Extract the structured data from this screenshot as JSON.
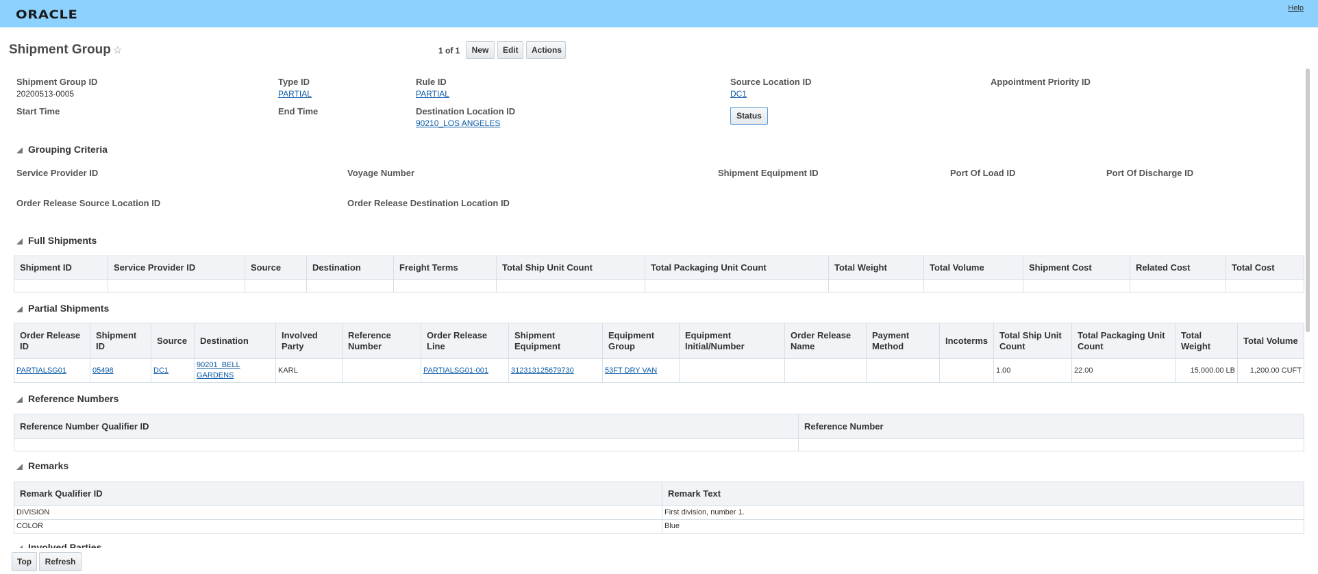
{
  "header": {
    "logo": "ORACLE",
    "help": "Help"
  },
  "page": {
    "title": "Shipment Group",
    "pager": "1 of 1",
    "new": "New",
    "edit": "Edit",
    "actions": "Actions",
    "status": "Status"
  },
  "fields": {
    "shipment_group_id": {
      "label": "Shipment Group ID",
      "value": "20200513-0005"
    },
    "type_id": {
      "label": "Type ID",
      "value": "PARTIAL"
    },
    "rule_id": {
      "label": "Rule ID",
      "value": "PARTIAL"
    },
    "source_location_id": {
      "label": "Source Location ID",
      "value": "DC1"
    },
    "appointment_priority_id": {
      "label": "Appointment Priority ID"
    },
    "start_time": {
      "label": "Start Time"
    },
    "end_time": {
      "label": "End Time"
    },
    "destination_location_id": {
      "label": "Destination Location ID",
      "value": "90210_LOS ANGELES"
    }
  },
  "grouping": {
    "title": "Grouping Criteria",
    "labels": [
      "Service Provider ID",
      "Voyage Number",
      "Shipment Equipment ID",
      "Port Of Load ID",
      "Port Of Discharge ID",
      "Order Release Source Location ID",
      "Order Release Destination Location ID"
    ]
  },
  "full_shipments": {
    "title": "Full Shipments",
    "columns": [
      "Shipment ID",
      "Service Provider ID",
      "Source",
      "Destination",
      "Freight Terms",
      "Total Ship Unit Count",
      "Total Packaging Unit Count",
      "Total Weight",
      "Total Volume",
      "Shipment Cost",
      "Related Cost",
      "Total Cost"
    ],
    "rows": [
      [
        "",
        "",
        "",
        "",
        "",
        "",
        "",
        "",
        "",
        "",
        "",
        ""
      ]
    ]
  },
  "partial_shipments": {
    "title": "Partial Shipments",
    "columns": [
      "Order Release ID",
      "Shipment ID",
      "Source",
      "Destination",
      "Involved Party",
      "Reference Number",
      "Order Release Line",
      "Shipment Equipment",
      "Equipment Group",
      "Equipment Initial/Number",
      "Order Release Name",
      "Payment Method",
      "Incoterms",
      "Total Ship Unit Count",
      "Total Packaging Unit Count",
      "Total Weight",
      "Total Volume"
    ],
    "rows": [
      [
        {
          "t": "PARTIALSG01",
          "link": true
        },
        {
          "t": "05498",
          "link": true
        },
        {
          "t": "DC1",
          "link": true
        },
        {
          "t": "90201_BELL GARDENS",
          "link": true
        },
        {
          "t": "KARL"
        },
        {
          "t": ""
        },
        {
          "t": "PARTIALSG01-001",
          "link": true
        },
        {
          "t": "312313125679730",
          "link": true
        },
        {
          "t": "53FT DRY VAN",
          "link": true
        },
        {
          "t": ""
        },
        {
          "t": ""
        },
        {
          "t": ""
        },
        {
          "t": ""
        },
        {
          "t": "1.00"
        },
        {
          "t": "22.00"
        },
        {
          "t": "15,000.00 LB",
          "num": true
        },
        {
          "t": "1,200.00 CUFT",
          "num": true
        }
      ]
    ]
  },
  "reference_numbers": {
    "title": "Reference Numbers",
    "columns": [
      "Reference Number Qualifier ID",
      "Reference Number"
    ],
    "rows": [
      [
        "",
        ""
      ]
    ]
  },
  "remarks": {
    "title": "Remarks",
    "columns": [
      "Remark Qualifier ID",
      "Remark Text"
    ],
    "rows": [
      [
        "DIVISION",
        "First division, number 1."
      ],
      [
        "COLOR",
        "Blue"
      ]
    ]
  },
  "involved_parties": {
    "title": "Involved Parties"
  },
  "footer": {
    "top": "Top",
    "refresh": "Refresh"
  }
}
